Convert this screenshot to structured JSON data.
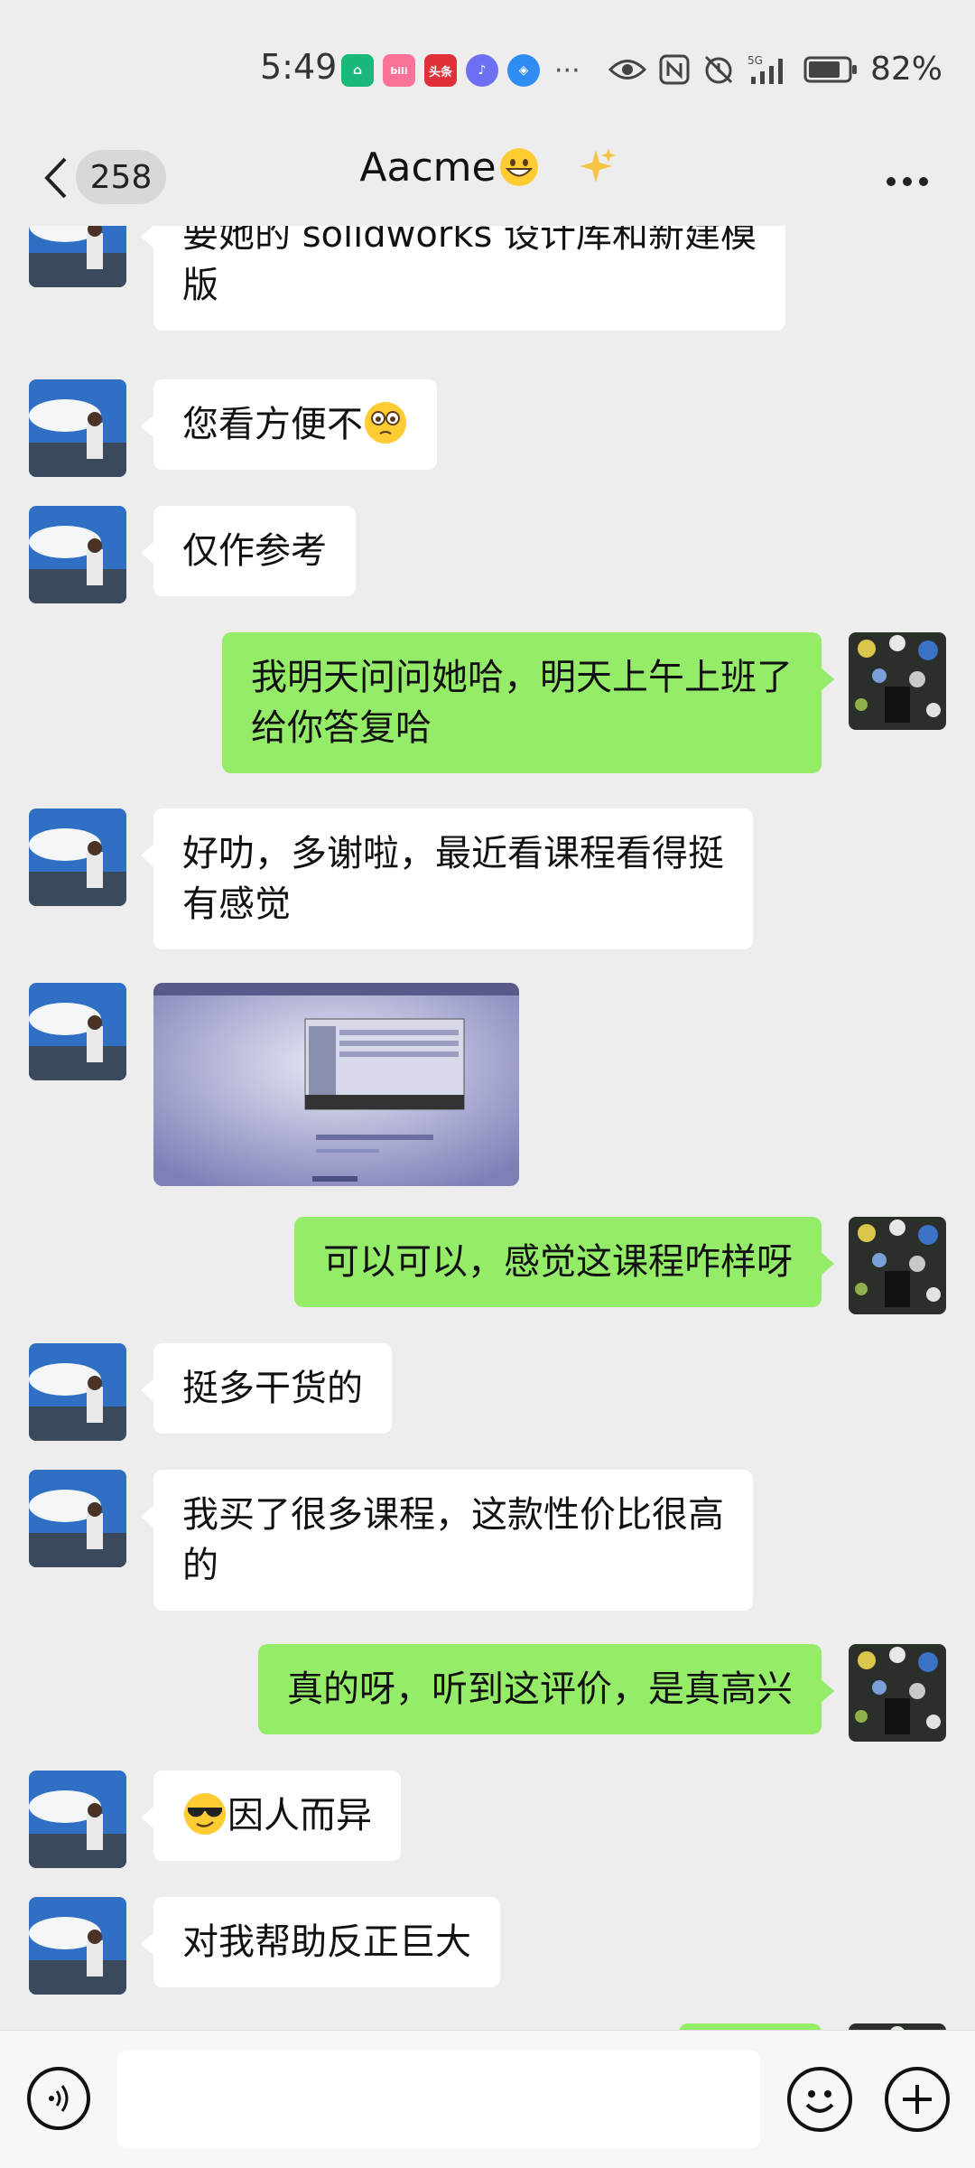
{
  "status_bar": {
    "time": "5:49",
    "notification_icons": [
      "mi-home-icon",
      "bilibili-icon",
      "toutiao-icon",
      "music-icon",
      "browser-icon"
    ],
    "notif_labels": [
      "",
      "bili",
      "头条",
      "",
      ""
    ],
    "more": "···",
    "signal_label": "5G",
    "battery_percent": "82%",
    "battery_level": 0.82
  },
  "nav": {
    "unread_count": "258",
    "title": "Aacme"
  },
  "messages": [
    {
      "side": "in",
      "text_lines": [
        "要她的 solidworks 设计库和新建模",
        "版"
      ]
    },
    {
      "side": "in",
      "text": "您看方便不"
    },
    {
      "side": "in",
      "text": "仅作参考"
    },
    {
      "side": "out",
      "text_lines": [
        "我明天问问她哈，明天上午上班了",
        "给你答复哈"
      ]
    },
    {
      "side": "in",
      "text_lines": [
        "好叻，多谢啦，最近看课程看得挺",
        "有感觉"
      ]
    },
    {
      "side": "in",
      "type": "image"
    },
    {
      "side": "out",
      "text": "可以可以，感觉这课程咋样呀"
    },
    {
      "side": "in",
      "text": "挺多干货的"
    },
    {
      "side": "in",
      "text_lines": [
        "我买了很多课程，这款性价比很高",
        "的"
      ]
    },
    {
      "side": "out",
      "text": "真的呀，听到这评价，是真高兴"
    },
    {
      "side": "in",
      "text": "因人而异"
    },
    {
      "side": "in",
      "text": "对我帮助反正巨大"
    }
  ],
  "input": {
    "value": "",
    "placeholder": ""
  },
  "colors": {
    "outgoing_bubble": "#95ec69",
    "incoming_bubble": "#ffffff",
    "background": "#ededed"
  }
}
